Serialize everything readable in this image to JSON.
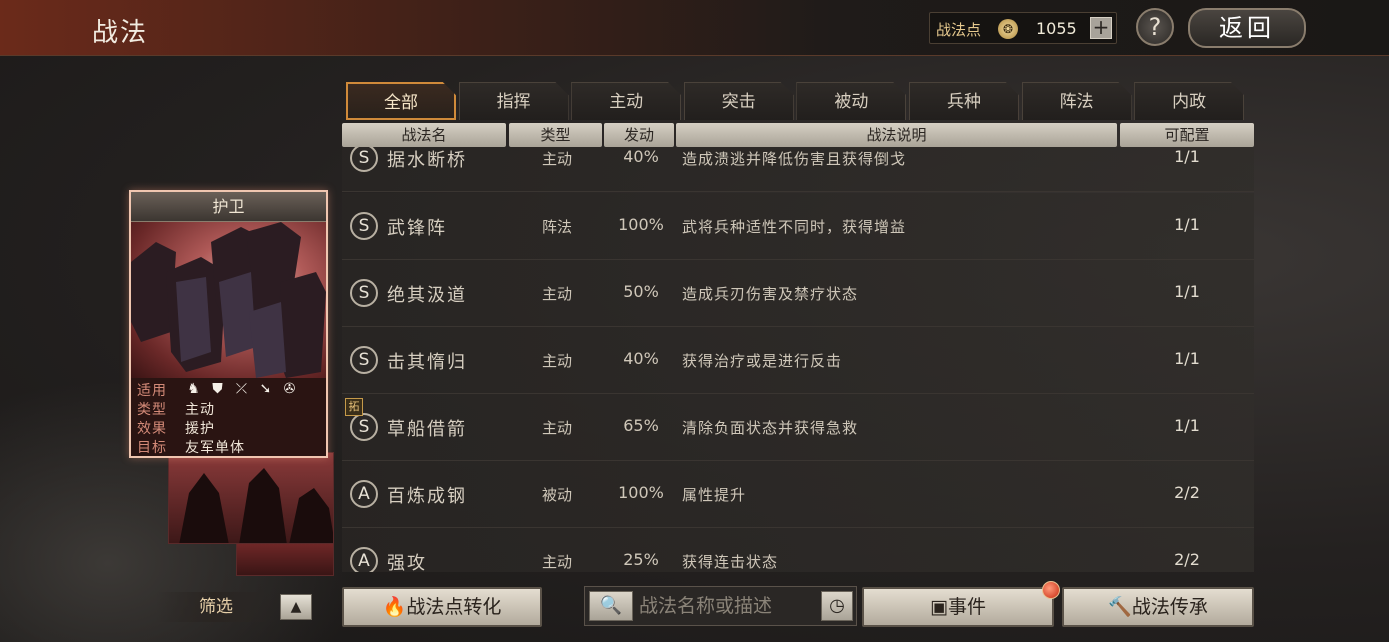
{
  "header": {
    "title": "战法",
    "points_label": "战法点",
    "points_value": "1055",
    "add_label": "+",
    "help_label": "?",
    "back_label": "返回"
  },
  "tabs": [
    "全部",
    "指挥",
    "主动",
    "突击",
    "被动",
    "兵种",
    "阵法",
    "内政"
  ],
  "columns": [
    "战法名",
    "类型",
    "发动",
    "战法说明",
    "可配置"
  ],
  "rows": [
    {
      "grade": "S",
      "name": "据水断桥",
      "type": "主动",
      "rate": "40%",
      "desc": "造成溃逃并降低伤害且获得倒戈",
      "cfg": "1/1"
    },
    {
      "grade": "S",
      "name": "武锋阵",
      "type": "阵法",
      "rate": "100%",
      "desc": "武将兵种适性不同时，获得增益",
      "cfg": "1/1"
    },
    {
      "grade": "S",
      "name": "绝其汲道",
      "type": "主动",
      "rate": "50%",
      "desc": "造成兵刃伤害及禁疗状态",
      "cfg": "1/1"
    },
    {
      "grade": "S",
      "name": "击其惰归",
      "type": "主动",
      "rate": "40%",
      "desc": "获得治疗或是进行反击",
      "cfg": "1/1"
    },
    {
      "grade": "S",
      "name": "草船借箭",
      "type": "主动",
      "rate": "65%",
      "desc": "清除负面状态并获得急救",
      "cfg": "1/1"
    },
    {
      "grade": "A",
      "name": "百炼成钢",
      "type": "被动",
      "rate": "100%",
      "desc": "属性提升",
      "cfg": "2/2"
    },
    {
      "grade": "A",
      "name": "强攻",
      "type": "主动",
      "rate": "25%",
      "desc": "获得连击状态",
      "cfg": "2/2"
    }
  ],
  "tuo_badge": "拓",
  "card": {
    "title": "护卫",
    "applies_label": "适用",
    "type_label": "类型",
    "type_value": "主动",
    "effect_label": "效果",
    "effect_value": "援护",
    "target_label": "目标",
    "target_value": "友军单体",
    "troop_icons": [
      "cavalry-icon",
      "shield-icon",
      "archer-icon",
      "spear-icon",
      "chariot-icon"
    ]
  },
  "bottom": {
    "filter_label": "筛选",
    "convert_label": "战法点转化",
    "search_placeholder": "战法名称或描述",
    "event_label": "事件",
    "inherit_label": "战法传承"
  }
}
